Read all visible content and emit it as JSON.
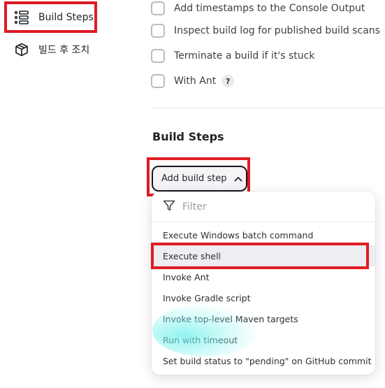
{
  "sidebar": {
    "items": [
      {
        "label": "Build Steps",
        "icon": "list-icon"
      },
      {
        "label": "빌드 후 조치",
        "icon": "cube-icon"
      }
    ]
  },
  "options": [
    {
      "label": "Add timestamps to the Console Output",
      "checked": false
    },
    {
      "label": "Inspect build log for published build scans",
      "checked": false
    },
    {
      "label": "Terminate a build if it's stuck",
      "checked": false
    },
    {
      "label": "With Ant",
      "checked": false,
      "help": "?"
    }
  ],
  "section": {
    "title": "Build Steps"
  },
  "add_button": {
    "label": "Add build step"
  },
  "dropdown": {
    "filter_placeholder": "Filter",
    "items": [
      "Execute Windows batch command",
      "Execute shell",
      "Invoke Ant",
      "Invoke Gradle script",
      "Invoke top-level Maven targets",
      "Run with timeout",
      "Set build status to \"pending\" on GitHub commit"
    ],
    "selected": "Execute shell"
  },
  "colors": {
    "highlight": "#e01b24",
    "selected_bg": "#ededf2"
  }
}
